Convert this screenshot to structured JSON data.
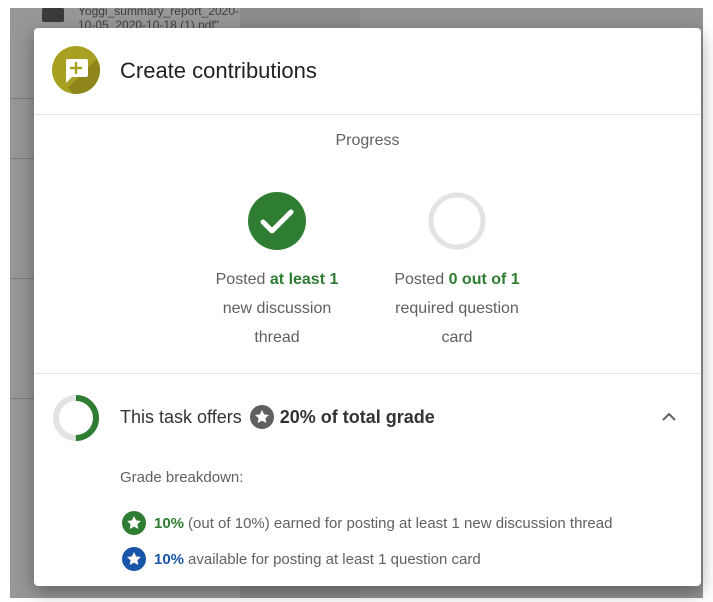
{
  "background": {
    "file_name_line1": "Yoggi_summary_report_2020-",
    "file_name_line2": "10-05_2020-10-18 (1).pdf\""
  },
  "dialog": {
    "title": "Create contributions",
    "header_icon": "add-comment-icon",
    "progress": {
      "label": "Progress",
      "items": [
        {
          "status": "complete",
          "prefix": "Posted",
          "highlight": "at least 1",
          "line2": "new discussion",
          "line3": "thread"
        },
        {
          "status": "incomplete",
          "prefix": "Posted",
          "highlight": "0 out of 1",
          "line2": "required question",
          "line3": "card"
        }
      ]
    },
    "grade": {
      "text_before": "This task offers",
      "value": "20% of total grade",
      "progress_fraction": 0.5,
      "breakdown_label": "Grade breakdown:",
      "rows": [
        {
          "percent": "10%",
          "text": "(out of 10%) earned for posting at least 1 new discussion thread",
          "icon": "green-star-badge-icon"
        },
        {
          "percent": "10%",
          "text": "available for posting at least 1 question card",
          "icon": "blue-star-badge-icon"
        }
      ]
    }
  },
  "colors": {
    "accent_green": "#2e7d32",
    "accent_blue": "#1a56a8",
    "header_icon": "#a8a020"
  }
}
